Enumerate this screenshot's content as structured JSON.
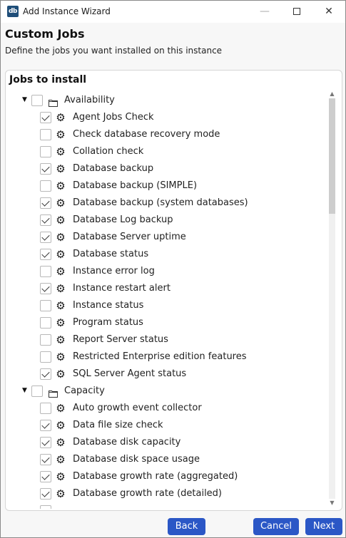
{
  "window": {
    "icon_text": "db",
    "title": "Add Instance Wizard"
  },
  "page": {
    "title": "Custom Jobs",
    "subtitle": "Define the jobs you want installed on this instance"
  },
  "panel": {
    "header": "Jobs to install"
  },
  "tree": {
    "groups": [
      {
        "label": "Availability",
        "expanded": true,
        "checked": false,
        "items": [
          {
            "label": "Agent Jobs Check",
            "checked": true
          },
          {
            "label": "Check database recovery mode",
            "checked": false
          },
          {
            "label": "Collation check",
            "checked": false
          },
          {
            "label": "Database backup",
            "checked": true
          },
          {
            "label": "Database backup (SIMPLE)",
            "checked": false
          },
          {
            "label": "Database backup (system databases)",
            "checked": true
          },
          {
            "label": "Database Log backup",
            "checked": true
          },
          {
            "label": "Database Server uptime",
            "checked": true
          },
          {
            "label": "Database status",
            "checked": true
          },
          {
            "label": "Instance error log",
            "checked": false
          },
          {
            "label": "Instance restart alert",
            "checked": true
          },
          {
            "label": "Instance status",
            "checked": false
          },
          {
            "label": "Program status",
            "checked": false
          },
          {
            "label": "Report Server status",
            "checked": false
          },
          {
            "label": "Restricted Enterprise edition features",
            "checked": false
          },
          {
            "label": "SQL Server Agent status",
            "checked": true
          }
        ]
      },
      {
        "label": "Capacity",
        "expanded": true,
        "checked": false,
        "items": [
          {
            "label": "Auto growth event collector",
            "checked": false
          },
          {
            "label": "Data file size check",
            "checked": true
          },
          {
            "label": "Database disk capacity",
            "checked": true
          },
          {
            "label": "Database disk space usage",
            "checked": true
          },
          {
            "label": "Database growth rate (aggregated)",
            "checked": true
          },
          {
            "label": "Database growth rate (detailed)",
            "checked": true
          }
        ]
      }
    ]
  },
  "buttons": {
    "back": "Back",
    "cancel": "Cancel",
    "next": "Next"
  },
  "colors": {
    "accent": "#2b57c6",
    "app_icon": "#1f4e79"
  }
}
